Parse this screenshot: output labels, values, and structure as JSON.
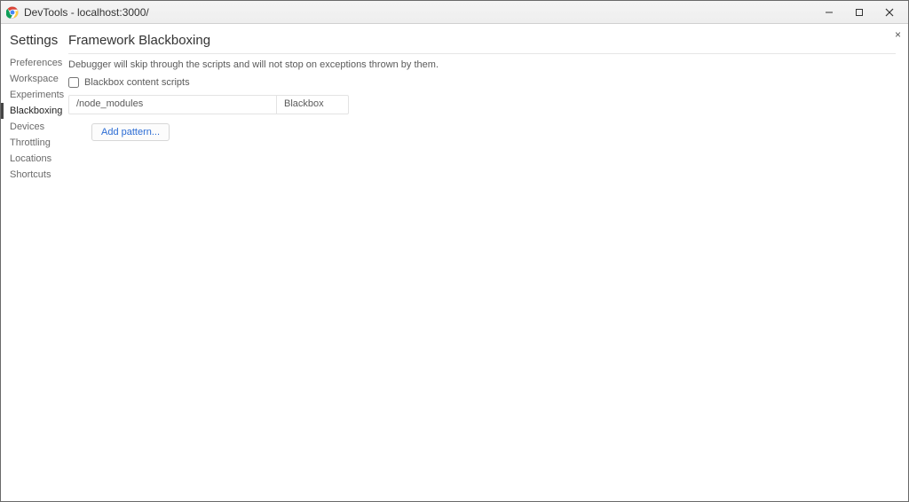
{
  "window": {
    "title": "DevTools - localhost:3000/"
  },
  "sidebar": {
    "header": "Settings",
    "items": [
      {
        "label": "Preferences"
      },
      {
        "label": "Workspace"
      },
      {
        "label": "Experiments"
      },
      {
        "label": "Blackboxing"
      },
      {
        "label": "Devices"
      },
      {
        "label": "Throttling"
      },
      {
        "label": "Locations"
      },
      {
        "label": "Shortcuts"
      }
    ],
    "activeIndex": 3
  },
  "main": {
    "header": "Framework Blackboxing",
    "description": "Debugger will skip through the scripts and will not stop on exceptions thrown by them.",
    "checkbox_label": "Blackbox content scripts",
    "checkbox_checked": false,
    "table": {
      "pattern": "/node_modules",
      "behavior": "Blackbox"
    },
    "add_button": "Add pattern..."
  },
  "close_label": "×"
}
